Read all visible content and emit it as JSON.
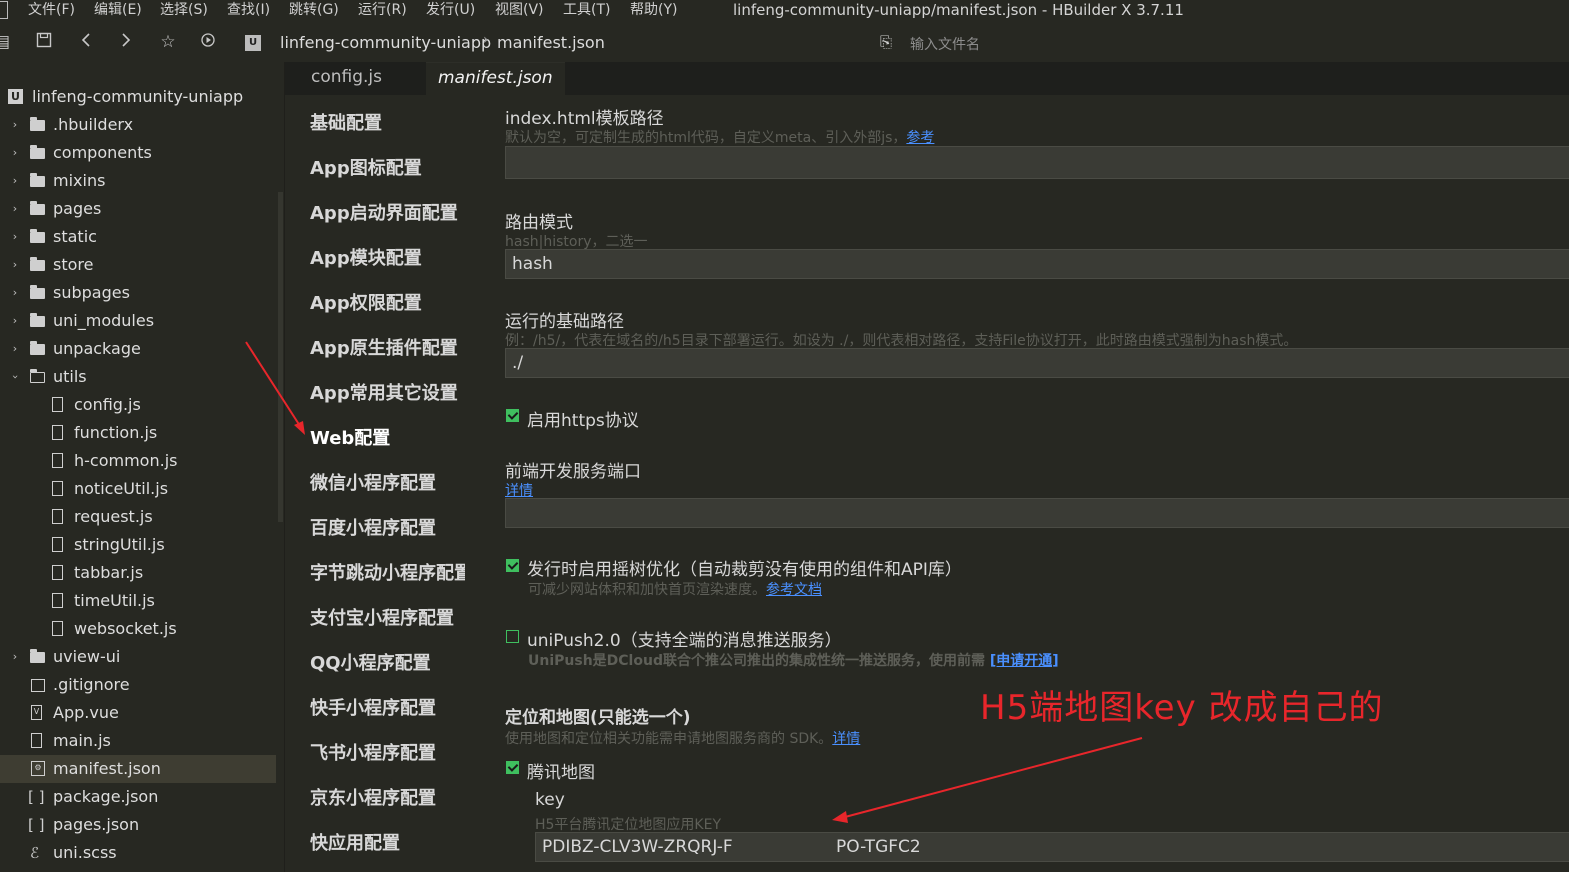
{
  "menubar": {
    "items": [
      "文件(F)",
      "编辑(E)",
      "选择(S)",
      "查找(I)",
      "跳转(G)",
      "运行(R)",
      "发行(U)",
      "视图(V)",
      "工具(T)",
      "帮助(Y)"
    ],
    "window_title": "linfeng-community-uniapp/manifest.json - HBuilder X 3.7.11"
  },
  "toolbar": {
    "breadcrumb_project": "linfeng-community-uniapp",
    "breadcrumb_separator": "›",
    "breadcrumb_file": "manifest.json",
    "search_placeholder": "输入文件名"
  },
  "sidebar": {
    "project": "linfeng-community-uniapp",
    "items": [
      {
        "label": ".hbuilderx",
        "type": "folder"
      },
      {
        "label": "components",
        "type": "folder"
      },
      {
        "label": "mixins",
        "type": "folder"
      },
      {
        "label": "pages",
        "type": "folder"
      },
      {
        "label": "static",
        "type": "folder"
      },
      {
        "label": "store",
        "type": "folder"
      },
      {
        "label": "subpages",
        "type": "folder"
      },
      {
        "label": "uni_modules",
        "type": "folder"
      },
      {
        "label": "unpackage",
        "type": "folder"
      },
      {
        "label": "utils",
        "type": "folder-open"
      },
      {
        "label": "config.js",
        "type": "file"
      },
      {
        "label": "function.js",
        "type": "file"
      },
      {
        "label": "h-common.js",
        "type": "file"
      },
      {
        "label": "noticeUtil.js",
        "type": "file"
      },
      {
        "label": "request.js",
        "type": "file"
      },
      {
        "label": "stringUtil.js",
        "type": "file"
      },
      {
        "label": "tabbar.js",
        "type": "file"
      },
      {
        "label": "timeUtil.js",
        "type": "file"
      },
      {
        "label": "websocket.js",
        "type": "file"
      },
      {
        "label": "uview-ui",
        "type": "folder"
      },
      {
        "label": ".gitignore",
        "type": "file"
      },
      {
        "label": "App.vue",
        "type": "file"
      },
      {
        "label": "main.js",
        "type": "file"
      },
      {
        "label": "manifest.json",
        "type": "file",
        "selected": true
      },
      {
        "label": "package.json",
        "type": "json"
      },
      {
        "label": "pages.json",
        "type": "json"
      },
      {
        "label": "uni.scss",
        "type": "file"
      }
    ]
  },
  "tabs": [
    {
      "label": "config.js",
      "active": false
    },
    {
      "label": "manifest.json",
      "active": true
    }
  ],
  "config_nav": [
    "基础配置",
    "App图标配置",
    "App启动界面配置",
    "App模块配置",
    "App权限配置",
    "App原生插件配置",
    "App常用其它设置",
    "Web配置",
    "微信小程序配置",
    "百度小程序配置",
    "字节跳动小程序配置",
    "支付宝小程序配置",
    "QQ小程序配置",
    "快手小程序配置",
    "飞书小程序配置",
    "京东小程序配置",
    "快应用配置"
  ],
  "config_nav_active": "Web配置",
  "web_config": {
    "template_title": "index.html模板路径",
    "template_desc": "默认为空，可定制生成的html代码，自定义meta、引入外部js，",
    "template_desc_link": "参考",
    "template_value": "",
    "router_title": "路由模式",
    "router_desc": "hash|history，二选一",
    "router_value": "hash",
    "base_title": "运行的基础路径",
    "base_desc": "例：/h5/，代表在域名的/h5目录下部署运行。如设为 ./，则代表相对路径，支持File协议打开，此时路由模式强制为hash模式。",
    "base_value": "./",
    "https_label": "启用https协议",
    "https_checked": true,
    "port_title": "前端开发服务端口",
    "port_link": "详情",
    "port_value": "",
    "treeshake_label": "发行时启用摇树优化（自动裁剪没有使用的组件和API库）",
    "treeshake_checked": true,
    "treeshake_desc": "可减少网站体积和加快首页渲染速度。",
    "treeshake_link": "参考文档",
    "unipush_label": "uniPush2.0（支持全端的消息推送服务）",
    "unipush_checked": false,
    "unipush_desc": "UniPush是DCloud联合个推公司推出的集成性统一推送服务，使用前需 ",
    "unipush_link": "[申请开通]",
    "map_title": "定位和地图(只能选一个)",
    "map_desc": "使用地图和定位相关功能需申请地图服务商的 SDK。",
    "map_link": "详情",
    "tencent_label": "腾讯地图",
    "tencent_checked": true,
    "key_title": "key",
    "key_desc": "H5平台腾讯定位地图应用KEY",
    "key_value": "PDIBZ-CLV3W-ZRQRJ-F",
    "key_value_end": "PO-TGFC2"
  },
  "annotation": {
    "text": "H5端地图key  改成自己的",
    "color": "#e8262b"
  }
}
